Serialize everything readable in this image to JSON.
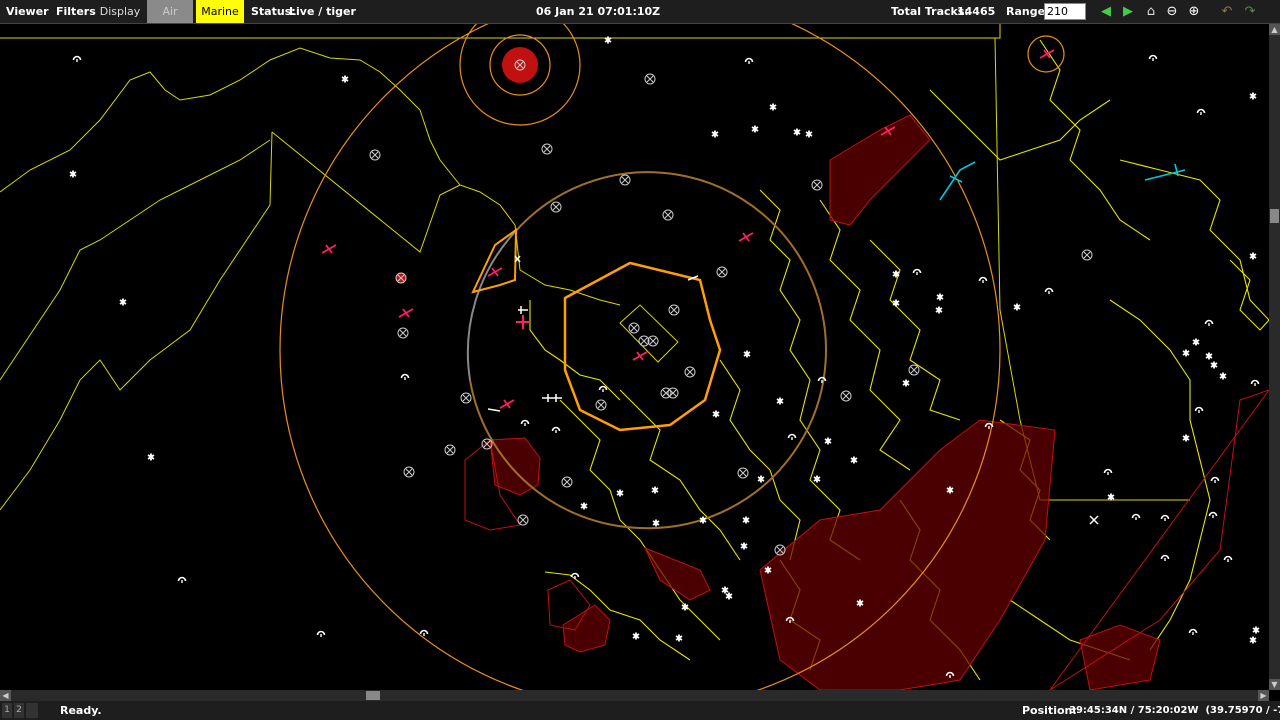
{
  "toolbar": {
    "viewer_label": "Viewer",
    "filters_label": "Filters:",
    "display_label": "Display",
    "air_label": "Air",
    "marine_label": "Marine",
    "status_label": "Status:",
    "status_value": "Live / tiger",
    "datetime": "06 Jan 21 07:01:10Z",
    "total_tracks_label": "Total Tracks:",
    "total_tracks_value": "14465",
    "range_label": "Range:",
    "range_value": "210",
    "icons": [
      "back-arrow-icon",
      "forward-arrow-icon",
      "home-icon",
      "zoom-out-icon",
      "zoom-in-icon",
      "undo-icon",
      "redo-icon"
    ]
  },
  "statusbar": {
    "pages": [
      "1",
      "2"
    ],
    "message": "Ready.",
    "position_label": "Position:",
    "position_value": "39:45:34N / 75:20:02W  (39.75970 / -75.33411)"
  },
  "colors": {
    "coastline": "#ffff00",
    "range_ring": "#ff9a1a",
    "restricted_zone": "#7a0000",
    "hostile_track": "#ff2060",
    "friendly_track": "#00e0ff",
    "toolbar_bg": "#1e1e1e",
    "marine_filter": "#ffff00",
    "air_filter": "#8a8a8a"
  }
}
